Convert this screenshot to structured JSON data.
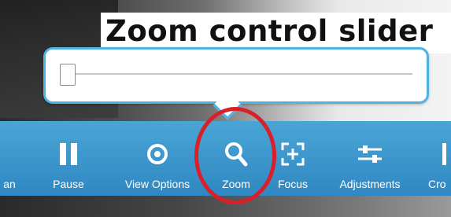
{
  "annotation": {
    "title": "Zoom control slider"
  },
  "zoom_slider": {
    "value": 0
  },
  "toolbar": {
    "items": [
      {
        "label": "an",
        "icon": "partial-icon"
      },
      {
        "label": "Pause",
        "icon": "pause-icon"
      },
      {
        "label": "View Options",
        "icon": "eye-icon"
      },
      {
        "label": "Zoom",
        "icon": "magnifier-icon"
      },
      {
        "label": "Focus",
        "icon": "focus-icon"
      },
      {
        "label": "Adjustments",
        "icon": "sliders-icon"
      },
      {
        "label": "Cro",
        "icon": "crop-icon"
      }
    ]
  },
  "colors": {
    "toolbar_top": "#4aa5d6",
    "toolbar_bottom": "#2f88c1",
    "popup_border": "#4fb3e3",
    "highlight": "#d9202a"
  }
}
